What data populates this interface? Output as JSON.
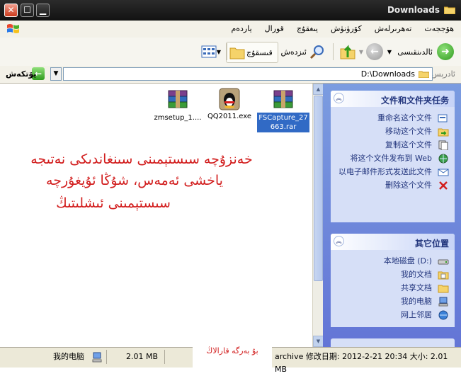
{
  "window": {
    "title": "Downloads"
  },
  "menu": [
    "ھۆججەت",
    "تەھرىرلەش",
    "كۆرۈنۈش",
    "يىغقۇچ",
    "قورال",
    "ياردەم"
  ],
  "toolbar": {
    "back_label": "ئالدىنقىسى",
    "search_label": "ئىزدەش",
    "folders_label": "قىسقۇچ"
  },
  "address": {
    "label": "ئادرېس",
    "value": "D:\\Downloads",
    "go_label": "يۆتكەش"
  },
  "files": [
    {
      "name": "zmsetup_1....",
      "icon": "winrar-archive-icon",
      "selected": false
    },
    {
      "name": "QQ2011.exe",
      "icon": "qq-penguin-icon",
      "selected": false
    },
    {
      "name": "FSCapture_27663.rar",
      "icon": "winrar-archive-icon",
      "selected": true
    }
  ],
  "overlay_text": [
    "خەنزۇچە سىستېمىنى سىنغاندىكى نەتىجە",
    "ياخشى ئەمەس، شۇڭا ئۇيغۇرچە ",
    "سىستېمىنى ئىشلىتىڭ"
  ],
  "task_panel": {
    "title": "文件和文件夹任务",
    "items": [
      {
        "label": "重命名这个文件",
        "icon": "rename-icon"
      },
      {
        "label": "移动这个文件",
        "icon": "move-icon"
      },
      {
        "label": "复制这个文件",
        "icon": "copy-icon"
      },
      {
        "label": "将这个文件发布到 Web",
        "icon": "web-publish-icon"
      },
      {
        "label": "以电子邮件形式发送此文件",
        "icon": "email-icon"
      },
      {
        "label": "删除这个文件",
        "icon": "delete-icon"
      }
    ]
  },
  "other_places": {
    "title": "其它位置",
    "items": [
      {
        "label": "本地磁盘 (D:)",
        "icon": "drive-icon"
      },
      {
        "label": "我的文档",
        "icon": "documents-icon"
      },
      {
        "label": "共享文档",
        "icon": "shared-folder-icon"
      },
      {
        "label": "我的电脑",
        "icon": "computer-icon"
      },
      {
        "label": "网上邻居",
        "icon": "network-icon"
      }
    ]
  },
  "status": {
    "computer": "我的电脑",
    "size_left": "2.01 MB",
    "overlay": "بۇ بەرگە قارالاڭ",
    "info": "archive 修改日期: 2012-2-21 20:34 大小: 2.01 MB"
  },
  "colors": {
    "taskpane_bg": "#6375d6",
    "selection": "#316ac5",
    "overlay_red": "#d21e1e",
    "link": "#21347c"
  }
}
